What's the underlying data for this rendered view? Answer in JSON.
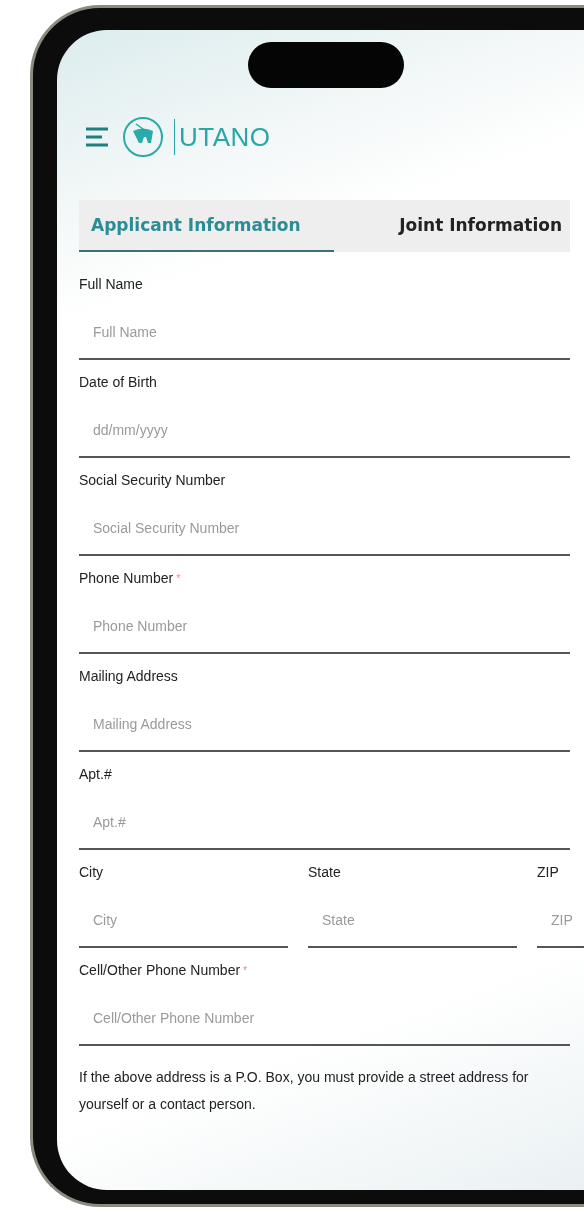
{
  "header": {
    "brand": "UTANO"
  },
  "tabs": [
    {
      "label": "Applicant Information",
      "selected": true
    },
    {
      "label": "Joint Information",
      "selected": false
    }
  ],
  "form": [
    {
      "kind": "single",
      "label": "Full Name",
      "placeholder": "Full Name"
    },
    {
      "kind": "single",
      "label": "Date of Birth",
      "placeholder": "dd/mm/yyyy"
    },
    {
      "kind": "single",
      "label": "Social Security Number",
      "placeholder": "Social Security Number"
    },
    {
      "kind": "single",
      "label": "Phone Number",
      "placeholder": "Phone Number",
      "mark": "*"
    },
    {
      "kind": "single",
      "label": "Mailing Address",
      "placeholder": "Mailing Address"
    },
    {
      "kind": "single",
      "label": "Apt.#",
      "placeholder": "Apt.#"
    },
    {
      "kind": "group",
      "fields": [
        {
          "label": "City",
          "placeholder": "City"
        },
        {
          "label": "State",
          "placeholder": "State"
        },
        {
          "label": "ZIP",
          "placeholder": "ZIP"
        }
      ]
    },
    {
      "kind": "single",
      "label": "Cell/Other Phone Number",
      "placeholder": "Cell/Other Phone Number",
      "mark": "*"
    }
  ],
  "note": "If the above address is a P.O. Box, you must provide a street address for yourself or a contact person."
}
